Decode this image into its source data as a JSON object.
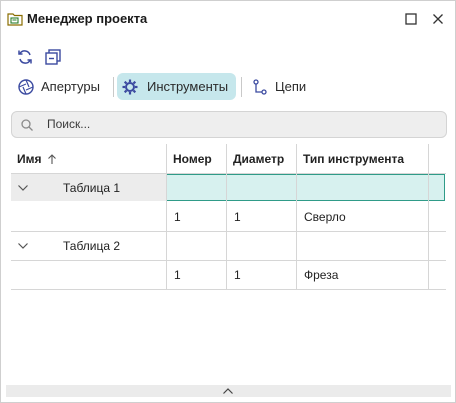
{
  "window": {
    "title": "Менеджер проекта"
  },
  "tabs": [
    {
      "label": "Апертуры",
      "icon": "aperture-icon"
    },
    {
      "label": "Инструменты",
      "icon": "tools-gear-icon",
      "active": true
    },
    {
      "label": "Цепи",
      "icon": "nets-icon"
    }
  ],
  "search": {
    "placeholder": "Поиск..."
  },
  "table": {
    "columns": [
      "Имя",
      "Номер",
      "Диаметр",
      "Тип инструмента"
    ],
    "groups": [
      {
        "name": "Таблица 1",
        "rows": [
          {
            "number": "1",
            "diameter": "1",
            "type": "Сверло"
          }
        ]
      },
      {
        "name": "Таблица 2",
        "rows": [
          {
            "number": "1",
            "diameter": "1",
            "type": "Фреза"
          }
        ]
      }
    ]
  },
  "colors": {
    "accent": "#c6e7ec",
    "selection_border": "#2f9b88",
    "selection_fill": "#d7f1ef"
  }
}
